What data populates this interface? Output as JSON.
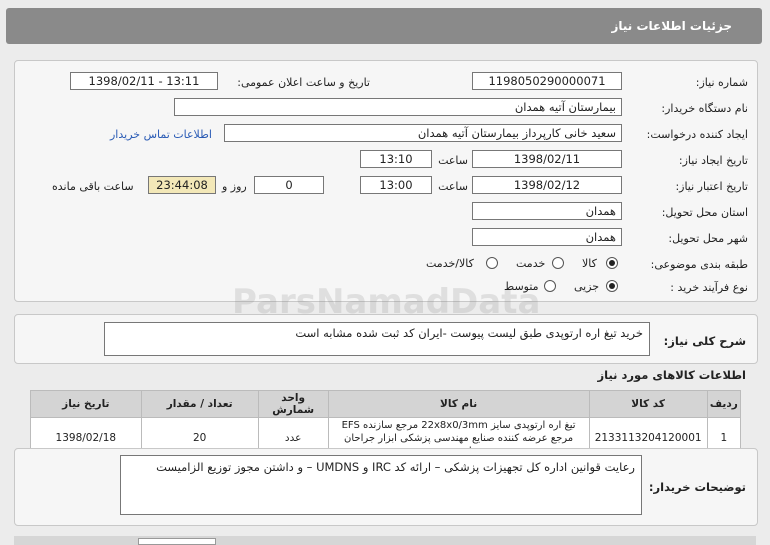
{
  "header": {
    "title": "جزئیات اطلاعات نیاز"
  },
  "form": {
    "need_number_label": "شماره نیاز:",
    "need_number": "1198050290000071",
    "announce_label": "تاریخ و ساعت اعلان عمومی:",
    "announce_value": "1398/02/11 - 13:11",
    "buyer_org_label": "نام دستگاه خریدار:",
    "buyer_org": "بیمارستان آتیه همدان",
    "requester_label": "ایجاد کننده درخواست:",
    "requester": "سعید خانی کارپرداز بیمارستان آتیه همدان",
    "contact_link": "اطلاعات تماس خریدار",
    "created_label": "تاریخ ایجاد نیاز:",
    "created_date": "1398/02/11",
    "time_label": "ساعت",
    "created_time": "13:10",
    "validity_label": "تاریخ اعتبار نیاز:",
    "validity_date": "1398/02/12",
    "validity_time": "13:00",
    "days_value": "0",
    "days_label": "روز و",
    "remaining_time": "23:44:08",
    "remaining_label": "ساعت باقی مانده",
    "province_label": "استان محل تحویل:",
    "province": "همدان",
    "city_label": "شهر محل تحویل:",
    "city": "همدان",
    "category_label": "طبقه بندی موضوعی:",
    "category_options": [
      "کالا",
      "خدمت",
      "کالا/خدمت"
    ],
    "purchase_type_label": "نوع فرآیند خرید :",
    "purchase_options": [
      "جزیی",
      "متوسط"
    ]
  },
  "summary": {
    "label": "شرح کلی نیاز:",
    "text": "خرید تیغ اره ارتوپدی طبق لیست پیوست -ایران کد ثبت شده مشابه است"
  },
  "items": {
    "title": "اطلاعات کالاهای مورد نیاز",
    "columns": [
      "ردیف",
      "کد کالا",
      "نام کالا",
      "واحد شمارش",
      "تعداد / مقدار",
      "تاریخ نیاز"
    ],
    "rows": [
      {
        "row": "1",
        "code": "2133113204120001",
        "name": "تیغ اره ارتوپدی سایز 22x8x0/3mm مرجع سازنده EFS مرجع عرضه کننده صنایع مهندسی پزشکی ابزار جراحان ارومیه",
        "unit": "عدد",
        "qty": "20",
        "date": "1398/02/18"
      }
    ]
  },
  "notes": {
    "label": "توضیحات خریدار:",
    "text": "رعایت قوانین اداره کل تجهیزات پزشکی – ارائه کد IRC و UMDNS – و داشتن مجوز توزیع الزامیست"
  },
  "watermark": {
    "brand": "ParsNamadData"
  }
}
